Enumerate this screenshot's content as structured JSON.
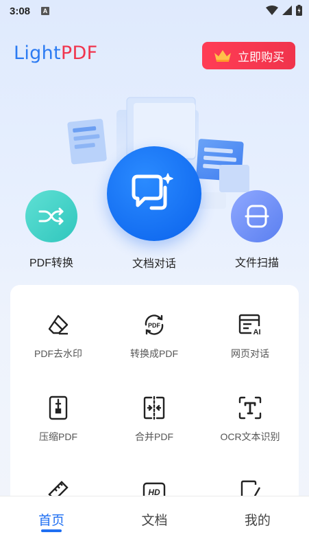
{
  "status_bar": {
    "time": "3:08",
    "notification_letter": "A"
  },
  "header": {
    "logo_light": "Light",
    "logo_pdf": "PDF",
    "buy_label": "立即购买"
  },
  "features": {
    "pdf_convert": "PDF转换",
    "doc_chat": "文档对话",
    "file_scan": "文件扫描"
  },
  "tools": [
    {
      "label": "PDF去水印",
      "icon": "eraser-icon"
    },
    {
      "label": "转换成PDF",
      "icon": "convert-pdf-icon"
    },
    {
      "label": "网页对话",
      "icon": "web-ai-icon"
    },
    {
      "label": "压缩PDF",
      "icon": "compress-icon"
    },
    {
      "label": "合并PDF",
      "icon": "merge-icon"
    },
    {
      "label": "OCR文本识别",
      "icon": "ocr-icon"
    },
    {
      "label": "",
      "icon": "ruler-icon"
    },
    {
      "label": "",
      "icon": "hd-icon"
    },
    {
      "label": "",
      "icon": "edit-doc-icon"
    }
  ],
  "bottom_nav": {
    "home": "首页",
    "docs": "文档",
    "mine": "我的"
  },
  "colors": {
    "accent": "#1f6ff2",
    "buy": "#f0344c",
    "logo_blue": "#2c7bf2",
    "logo_red": "#f0354e"
  }
}
